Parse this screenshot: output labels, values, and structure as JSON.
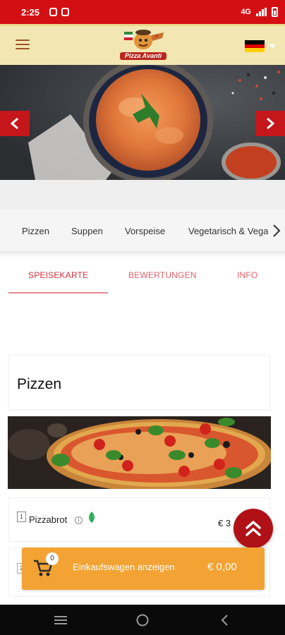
{
  "status_bar": {
    "time": "2:25",
    "network": "4G"
  },
  "header": {
    "logo_text": "Pizza Avanti",
    "language": "Deutsch",
    "flag_colors": [
      "#000000",
      "#dd0000",
      "#ffce00"
    ]
  },
  "hero": {
    "prev_icon": "chevron-left-icon",
    "next_icon": "chevron-right-icon"
  },
  "categories": {
    "items": [
      {
        "label": "Pizzen"
      },
      {
        "label": "Suppen"
      },
      {
        "label": "Vorspeise"
      },
      {
        "label": "Vegetarisch & Vega"
      }
    ]
  },
  "tabs": [
    {
      "label": "SPEISEKARTE",
      "active": true
    },
    {
      "label": "BEWERTUNGEN",
      "active": false
    },
    {
      "label": "INFO",
      "active": false
    }
  ],
  "menu": {
    "section_title": "Pizzen",
    "items": [
      {
        "number": "1",
        "name": "Pizzabrot",
        "price": "€ 3",
        "vegetarian": true
      },
      {
        "number": "2"
      }
    ]
  },
  "cart": {
    "count": "0",
    "label": "Einkaufswagen anzeigen",
    "total": "€ 0,00"
  },
  "colors": {
    "brand_red": "#d40f14",
    "header_bg": "#f2e7b2",
    "accent_orange": "#f3a334",
    "tab_active": "#d4323d"
  }
}
